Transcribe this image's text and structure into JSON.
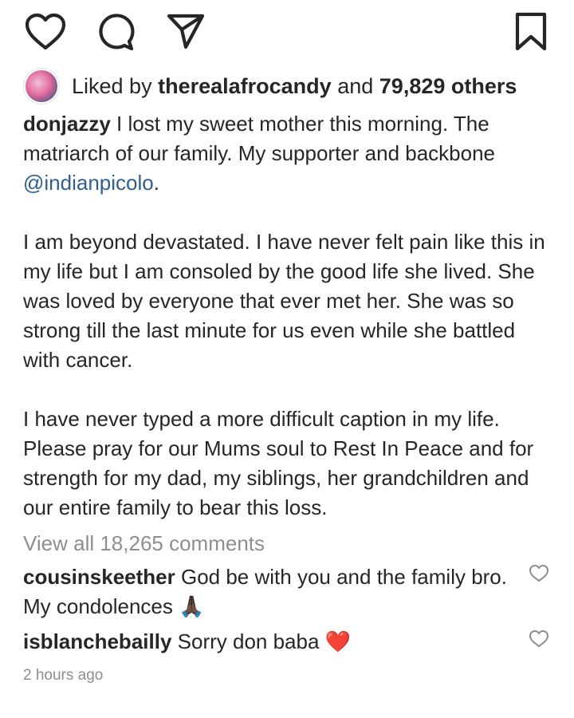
{
  "actions": {
    "like_icon": "heart-outline-icon",
    "comment_icon": "speech-bubble-icon",
    "share_icon": "paper-plane-icon",
    "save_icon": "bookmark-icon"
  },
  "likes": {
    "prefix": "Liked by",
    "user": "therealafrocandy",
    "conjunction": "and",
    "others": "79,829 others"
  },
  "caption": {
    "username": "donjazzy",
    "line1": "I lost my sweet mother this morning. The matriarch of our family. My supporter and backbone",
    "mention": "@indianpicolo",
    "line1_end": ".",
    "paragraph2": "I am beyond devastated. I have never felt pain like this in my life but I am consoled by the good life she lived. She was loved by everyone that ever met her. She was so strong till the last minute for us even while she battled with cancer.",
    "paragraph3": "I have never typed a more difficult caption in my life. Please pray for our Mums soul to Rest In Peace and for strength for my dad, my siblings, her grandchildren and our entire family to bear this loss."
  },
  "view_all_comments": "View all 18,265 comments",
  "comments": [
    {
      "username": "cousinskeether",
      "text": "God be with you and the family bro. My condolences",
      "emoji": "🙏🏿"
    },
    {
      "username": "isblanchebailly",
      "text": "Sorry don baba",
      "emoji": "❤️"
    }
  ],
  "timestamp": "2 hours ago",
  "colors": {
    "text": "#262626",
    "muted": "#8e8e8e",
    "mention": "#2f5f8f",
    "heart_emoji": "#e0242f"
  }
}
